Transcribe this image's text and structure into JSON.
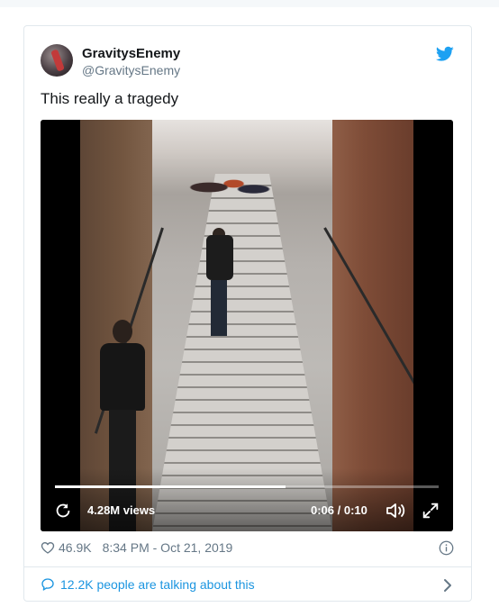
{
  "tweet": {
    "display_name": "GravitysEnemy",
    "handle": "@GravitysEnemy",
    "text": "This really a tragedy"
  },
  "video": {
    "progress_fraction": 0.6,
    "views": "4.28M views",
    "time": "0:06 / 0:10"
  },
  "meta": {
    "likes": "46.9K",
    "timestamp": "8:34 PM - Oct 21, 2019"
  },
  "footer": {
    "talking": "12.2K people are talking about this"
  },
  "icons": {
    "brand": "twitter-bird-icon",
    "like": "heart-icon",
    "info": "info-icon",
    "conversation": "speech-bubble-icon",
    "more": "chevron-right-icon",
    "replay": "replay-icon",
    "volume": "volume-icon",
    "fullscreen": "fullscreen-icon"
  },
  "colors": {
    "brand_blue": "#1da1f2",
    "link_blue": "#1b95e0",
    "muted_gray": "#657786"
  }
}
